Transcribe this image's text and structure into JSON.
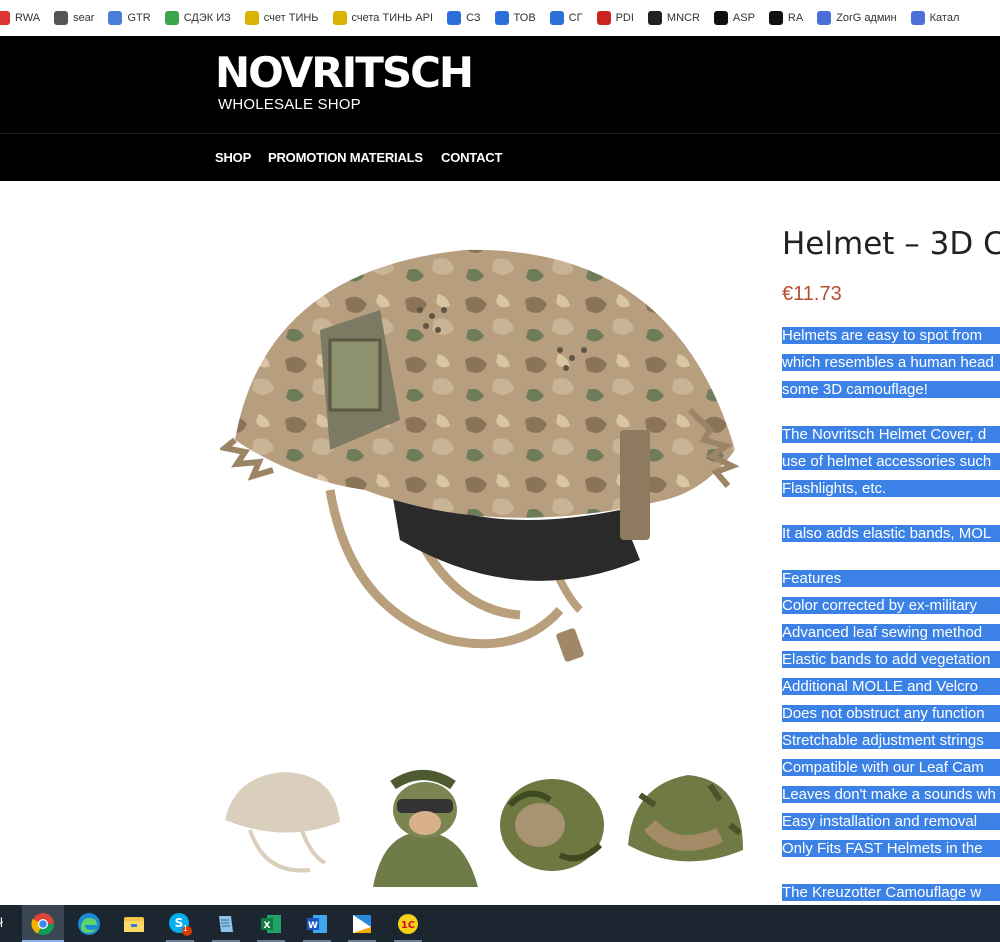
{
  "bookmarks": [
    {
      "label": "RWA",
      "color": "#d33"
    },
    {
      "label": "sear",
      "color": "#555"
    },
    {
      "label": "GTR",
      "color": "#4a7fd8"
    },
    {
      "label": "СДЭК ИЗ",
      "color": "#3aa84a"
    },
    {
      "label": "счет ТИНЬ",
      "color": "#d8b400"
    },
    {
      "label": "счета ТИНЬ API",
      "color": "#d8b400"
    },
    {
      "label": "СЗ",
      "color": "#2b6fd8"
    },
    {
      "label": "ТОВ",
      "color": "#2b6fd8"
    },
    {
      "label": "СГ",
      "color": "#2b6fd8"
    },
    {
      "label": "PDI",
      "color": "#c22"
    },
    {
      "label": "MNCR",
      "color": "#222"
    },
    {
      "label": "ASP",
      "color": "#111"
    },
    {
      "label": "RA",
      "color": "#111"
    },
    {
      "label": "ZorG админ",
      "color": "#4a6fd8"
    },
    {
      "label": "Катал",
      "color": "#4a6fd8"
    }
  ],
  "header": {
    "logo": "NOVRITSCH",
    "logo_sub": "WHOLESALE SHOP"
  },
  "nav": {
    "items": [
      "SHOP",
      "PROMOTION MATERIALS",
      "CONTACT"
    ]
  },
  "product": {
    "title": "Helmet – 3D C",
    "price": "€11.73",
    "description_lines": [
      "Helmets are easy to spot from",
      "which resembles a human head",
      "some 3D camouflage!",
      "",
      "The Novritsch Helmet Cover, d",
      "use of helmet accessories such",
      "Flashlights, etc.",
      "",
      "It also adds elastic bands, MOL",
      "",
      "Features",
      "Color corrected by ex-military",
      "Advanced leaf sewing method",
      "Elastic bands to add vegetation",
      "Additional MOLLE and Velcro",
      "Does not obstruct any function",
      "Stretchable adjustment strings",
      "Compatible with our Leaf Cam",
      "Leaves don't make a sounds wh",
      "Easy installation and removal",
      "Only Fits FAST Helmets in the",
      "",
      "The Kreuzotter Camouflage w"
    ]
  },
  "taskbar": {
    "icons": [
      "chrome-icon",
      "edge-icon",
      "file-explorer-icon",
      "skype-icon",
      "notepad-icon",
      "excel-icon",
      "word-icon",
      "paint-icon",
      "1c-icon"
    ],
    "skype_badge": "1"
  }
}
